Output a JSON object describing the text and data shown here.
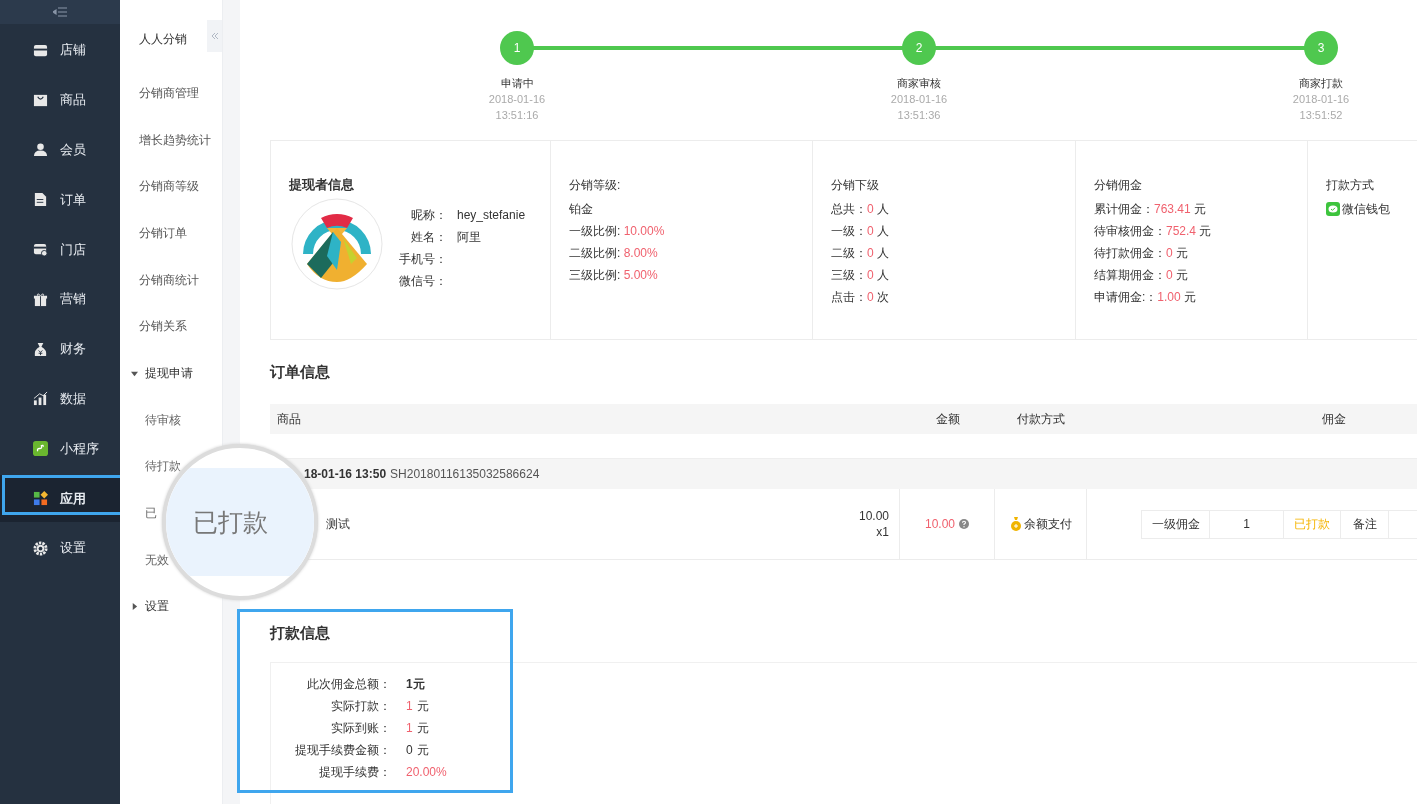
{
  "sidebar": {
    "items": [
      {
        "label": "店铺",
        "selected": false,
        "highlighted": false
      },
      {
        "label": "商品",
        "selected": false,
        "highlighted": false
      },
      {
        "label": "会员",
        "selected": false,
        "highlighted": false
      },
      {
        "label": "订单",
        "selected": false,
        "highlighted": false
      },
      {
        "label": "门店",
        "selected": false,
        "highlighted": false
      },
      {
        "label": "营销",
        "selected": false,
        "highlighted": false
      },
      {
        "label": "财务",
        "selected": false,
        "highlighted": false
      },
      {
        "label": "数据",
        "selected": false,
        "highlighted": false
      },
      {
        "label": "小程序",
        "selected": false,
        "highlighted": false
      },
      {
        "label": "应用",
        "selected": true,
        "highlighted": true
      },
      {
        "label": "设置",
        "selected": false,
        "highlighted": false
      }
    ]
  },
  "submenu": {
    "title": "人人分销",
    "items": [
      {
        "label": "分销商管理",
        "kind": "link"
      },
      {
        "label": "增长趋势统计",
        "kind": "link"
      },
      {
        "label": "分销商等级",
        "kind": "link"
      },
      {
        "label": "分销订单",
        "kind": "link"
      },
      {
        "label": "分销商统计",
        "kind": "link"
      },
      {
        "label": "分销关系",
        "kind": "link"
      },
      {
        "label": "提现申请",
        "kind": "group",
        "expanded": true,
        "children": [
          {
            "label": "待审核"
          },
          {
            "label": "待打款"
          },
          {
            "label": "已"
          },
          {
            "label": "无效"
          }
        ]
      },
      {
        "label": "设置",
        "kind": "group",
        "expanded": false
      }
    ]
  },
  "magnifier": {
    "text": "已打款"
  },
  "steps": [
    {
      "number": "1",
      "label": "申请中",
      "date": "2018-01-16",
      "time": "13:51:16",
      "done": true
    },
    {
      "number": "2",
      "label": "商家审核",
      "date": "2018-01-16",
      "time": "13:51:36",
      "done": true
    },
    {
      "number": "3",
      "label": "商家打款",
      "date": "2018-01-16",
      "time": "13:51:52",
      "done": true
    }
  ],
  "withdrawer": {
    "title": "提现者信息",
    "fields": [
      {
        "label": "昵称：",
        "value": "hey_stefanie"
      },
      {
        "label": "姓名：",
        "value": "阿里"
      },
      {
        "label": "手机号："
      },
      {
        "label": "微信号："
      }
    ]
  },
  "grade_panel": {
    "title": "分销等级:",
    "grade": "铂金",
    "ratios": [
      {
        "label": "一级比例:",
        "value": "10.00%"
      },
      {
        "label": "二级比例:",
        "value": "8.00%"
      },
      {
        "label": "三级比例:",
        "value": "5.00%"
      }
    ]
  },
  "downline": {
    "title": "分销下级",
    "items": [
      {
        "label": "总共：",
        "value": "0",
        "unit": "人"
      },
      {
        "label": "一级：",
        "value": "0",
        "unit": "人"
      },
      {
        "label": "二级：",
        "value": "0",
        "unit": "人"
      },
      {
        "label": "三级：",
        "value": "0",
        "unit": "人"
      },
      {
        "label": "点击：",
        "value": "0",
        "unit": "次"
      }
    ]
  },
  "commission": {
    "title": "分销佣金",
    "items": [
      {
        "label": "累计佣金：",
        "value": "763.41",
        "unit": "元"
      },
      {
        "label": "待审核佣金：",
        "value": "752.4",
        "unit": "元"
      },
      {
        "label": "待打款佣金：",
        "value": "0",
        "unit": "元"
      },
      {
        "label": "结算期佣金：",
        "value": "0",
        "unit": "元"
      },
      {
        "label": "申请佣金:：",
        "value": "1.00",
        "unit": "元"
      }
    ]
  },
  "payment_method": {
    "title": "打款方式",
    "method": "微信钱包"
  },
  "order_info": {
    "title": "订单信息",
    "columns": [
      "商品",
      "金额",
      "付款方式",
      "佣金"
    ],
    "orders": [
      {
        "date": "18-01-16 13:50",
        "order_no": "SH20180116135032586624",
        "items": [
          {
            "name": "测试",
            "price": "10.00",
            "quantity": "x1",
            "amount": "10.00",
            "payment": "余额支付",
            "commission": {
              "tier": "一级佣金",
              "value": "1",
              "status": "已打款"
            },
            "note_button": "备注"
          }
        ]
      }
    ]
  },
  "payout": {
    "title": "打款信息",
    "highlighted": true,
    "rows": [
      {
        "label": "此次佣金总额：",
        "value": "1元",
        "kind": "total"
      },
      {
        "label": "实际打款：",
        "value": "1",
        "unit": "元",
        "kind": "amount"
      },
      {
        "label": "实际到账：",
        "value": "1",
        "unit": "元",
        "kind": "amount"
      },
      {
        "label": "提现手续费金额：",
        "value": "0",
        "unit": "元",
        "kind": "plain"
      },
      {
        "label": "提现手续费：",
        "value": "20.00%",
        "kind": "amount"
      }
    ]
  }
}
